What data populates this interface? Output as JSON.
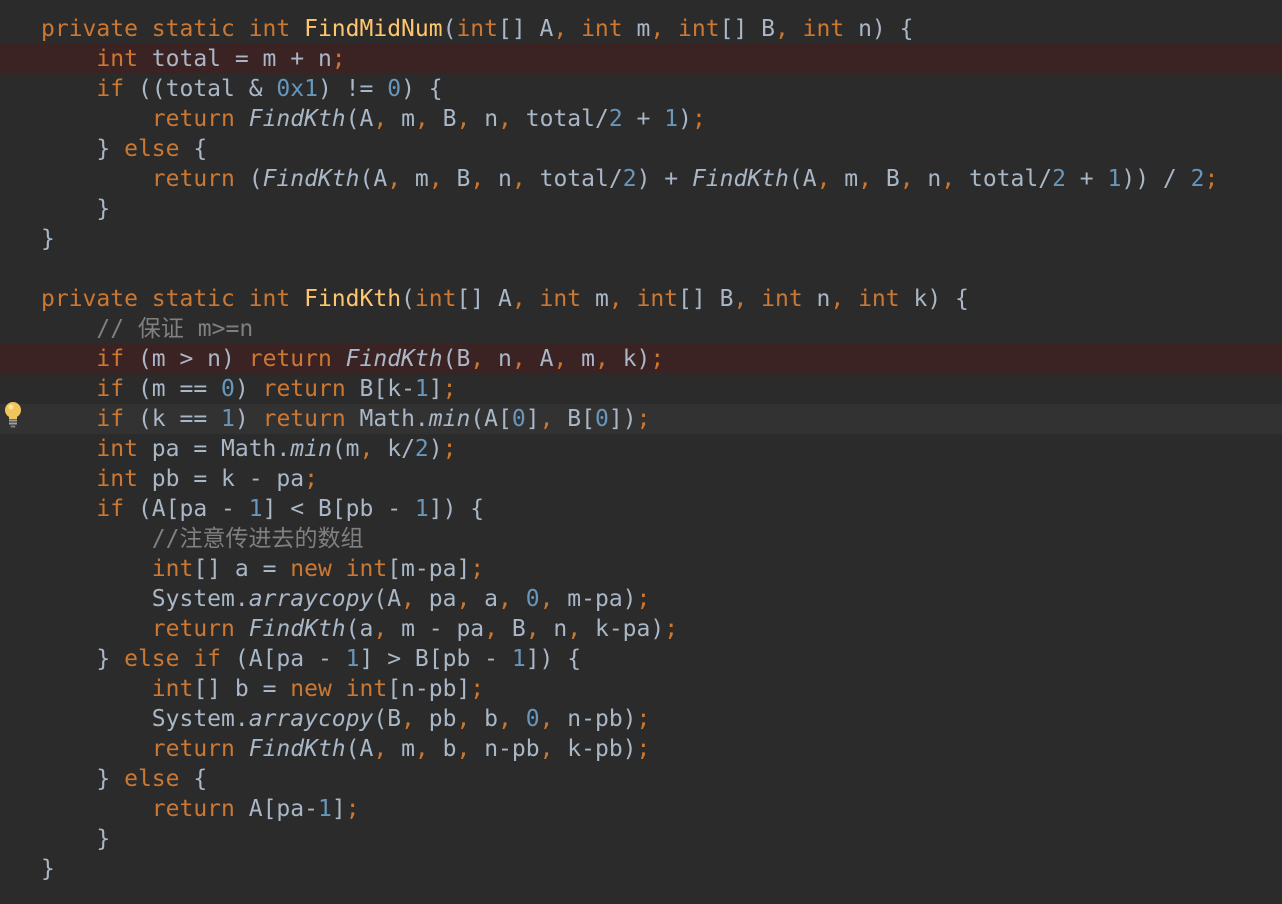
{
  "editor": {
    "language": "Java",
    "colors": {
      "background": "#2b2b2b",
      "keyword": "#cc7832",
      "method_declaration": "#ffc66d",
      "number": "#6897bb",
      "text": "#a9b7c6",
      "comment": "#808080",
      "error_line_background": "#3b2324",
      "caret_line_background": "#323232"
    },
    "gutter": {
      "intention_icon": "lightbulb-icon",
      "intention_line": 15
    },
    "lines": [
      {
        "hl": "",
        "tokens": [
          [
            "kw",
            "private static int "
          ],
          [
            "fn",
            "FindMidNum"
          ],
          [
            "tx",
            "("
          ],
          [
            "kw",
            "int"
          ],
          [
            "tx",
            "[] A"
          ],
          [
            "kw",
            ", int "
          ],
          [
            "tx",
            "m"
          ],
          [
            "kw",
            ", int"
          ],
          [
            "tx",
            "[] B"
          ],
          [
            "kw",
            ", int "
          ],
          [
            "tx",
            "n) {"
          ]
        ]
      },
      {
        "hl": "error",
        "tokens": [
          [
            "kw",
            "    int "
          ],
          [
            "tx",
            "total = m + n"
          ],
          [
            "kw",
            ";"
          ]
        ]
      },
      {
        "hl": "",
        "tokens": [
          [
            "kw",
            "    if "
          ],
          [
            "tx",
            "((total & "
          ],
          [
            "num",
            "0x1"
          ],
          [
            "tx",
            ") != "
          ],
          [
            "num",
            "0"
          ],
          [
            "tx",
            ") {"
          ]
        ]
      },
      {
        "hl": "",
        "tokens": [
          [
            "kw",
            "        return "
          ],
          [
            "it",
            "FindKth"
          ],
          [
            "tx",
            "(A"
          ],
          [
            "kw",
            ", "
          ],
          [
            "tx",
            "m"
          ],
          [
            "kw",
            ", "
          ],
          [
            "tx",
            "B"
          ],
          [
            "kw",
            ", "
          ],
          [
            "tx",
            "n"
          ],
          [
            "kw",
            ", "
          ],
          [
            "tx",
            "total/"
          ],
          [
            "num",
            "2"
          ],
          [
            "tx",
            " + "
          ],
          [
            "num",
            "1"
          ],
          [
            "tx",
            ")"
          ],
          [
            "kw",
            ";"
          ]
        ]
      },
      {
        "hl": "",
        "tokens": [
          [
            "tx",
            "    } "
          ],
          [
            "kw",
            "else "
          ],
          [
            "tx",
            "{"
          ]
        ]
      },
      {
        "hl": "",
        "tokens": [
          [
            "kw",
            "        return "
          ],
          [
            "tx",
            "("
          ],
          [
            "it",
            "FindKth"
          ],
          [
            "tx",
            "(A"
          ],
          [
            "kw",
            ", "
          ],
          [
            "tx",
            "m"
          ],
          [
            "kw",
            ", "
          ],
          [
            "tx",
            "B"
          ],
          [
            "kw",
            ", "
          ],
          [
            "tx",
            "n"
          ],
          [
            "kw",
            ", "
          ],
          [
            "tx",
            "total/"
          ],
          [
            "num",
            "2"
          ],
          [
            "tx",
            ") + "
          ],
          [
            "it",
            "FindKth"
          ],
          [
            "tx",
            "(A"
          ],
          [
            "kw",
            ", "
          ],
          [
            "tx",
            "m"
          ],
          [
            "kw",
            ", "
          ],
          [
            "tx",
            "B"
          ],
          [
            "kw",
            ", "
          ],
          [
            "tx",
            "n"
          ],
          [
            "kw",
            ", "
          ],
          [
            "tx",
            "total/"
          ],
          [
            "num",
            "2"
          ],
          [
            "tx",
            " + "
          ],
          [
            "num",
            "1"
          ],
          [
            "tx",
            ")) / "
          ],
          [
            "num",
            "2"
          ],
          [
            "kw",
            ";"
          ]
        ]
      },
      {
        "hl": "",
        "tokens": [
          [
            "tx",
            "    }"
          ]
        ]
      },
      {
        "hl": "",
        "tokens": [
          [
            "tx",
            "}"
          ]
        ]
      },
      {
        "hl": "",
        "tokens": []
      },
      {
        "hl": "",
        "tokens": [
          [
            "kw",
            "private static int "
          ],
          [
            "fn",
            "FindKth"
          ],
          [
            "tx",
            "("
          ],
          [
            "kw",
            "int"
          ],
          [
            "tx",
            "[] A"
          ],
          [
            "kw",
            ", int "
          ],
          [
            "tx",
            "m"
          ],
          [
            "kw",
            ", int"
          ],
          [
            "tx",
            "[] B"
          ],
          [
            "kw",
            ", int "
          ],
          [
            "tx",
            "n"
          ],
          [
            "kw",
            ", int "
          ],
          [
            "tx",
            "k) {"
          ]
        ]
      },
      {
        "hl": "",
        "tokens": [
          [
            "cm",
            "    // 保证 m>=n"
          ]
        ]
      },
      {
        "hl": "error",
        "tokens": [
          [
            "kw",
            "    if "
          ],
          [
            "tx",
            "(m > n) "
          ],
          [
            "kw",
            "return "
          ],
          [
            "it",
            "FindKth"
          ],
          [
            "tx",
            "(B"
          ],
          [
            "kw",
            ", "
          ],
          [
            "tx",
            "n"
          ],
          [
            "kw",
            ", "
          ],
          [
            "tx",
            "A"
          ],
          [
            "kw",
            ", "
          ],
          [
            "tx",
            "m"
          ],
          [
            "kw",
            ", "
          ],
          [
            "tx",
            "k)"
          ],
          [
            "kw",
            ";"
          ]
        ]
      },
      {
        "hl": "",
        "tokens": [
          [
            "kw",
            "    if "
          ],
          [
            "tx",
            "(m == "
          ],
          [
            "num",
            "0"
          ],
          [
            "tx",
            ") "
          ],
          [
            "kw",
            "return "
          ],
          [
            "tx",
            "B[k-"
          ],
          [
            "num",
            "1"
          ],
          [
            "tx",
            "]"
          ],
          [
            "kw",
            ";"
          ]
        ]
      },
      {
        "hl": "caret",
        "tokens": [
          [
            "kw",
            "    if "
          ],
          [
            "tx",
            "(k == "
          ],
          [
            "num",
            "1"
          ],
          [
            "tx",
            ") "
          ],
          [
            "kw",
            "return "
          ],
          [
            "tx",
            "Math."
          ],
          [
            "it",
            "min"
          ],
          [
            "tx",
            "(A["
          ],
          [
            "num",
            "0"
          ],
          [
            "tx",
            "]"
          ],
          [
            "kw",
            ", "
          ],
          [
            "tx",
            "B["
          ],
          [
            "num",
            "0"
          ],
          [
            "tx",
            "])"
          ],
          [
            "kw",
            ";"
          ]
        ]
      },
      {
        "hl": "",
        "tokens": [
          [
            "kw",
            "    int "
          ],
          [
            "tx",
            "pa = Math."
          ],
          [
            "it",
            "min"
          ],
          [
            "tx",
            "(m"
          ],
          [
            "kw",
            ", "
          ],
          [
            "tx",
            "k/"
          ],
          [
            "num",
            "2"
          ],
          [
            "tx",
            ")"
          ],
          [
            "kw",
            ";"
          ]
        ]
      },
      {
        "hl": "",
        "tokens": [
          [
            "kw",
            "    int "
          ],
          [
            "tx",
            "pb = k - pa"
          ],
          [
            "kw",
            ";"
          ]
        ]
      },
      {
        "hl": "",
        "tokens": [
          [
            "kw",
            "    if "
          ],
          [
            "tx",
            "(A[pa - "
          ],
          [
            "num",
            "1"
          ],
          [
            "tx",
            "] < B[pb - "
          ],
          [
            "num",
            "1"
          ],
          [
            "tx",
            "]) {"
          ]
        ]
      },
      {
        "hl": "",
        "tokens": [
          [
            "cm",
            "        //注意传进去的数组"
          ]
        ]
      },
      {
        "hl": "",
        "tokens": [
          [
            "kw",
            "        int"
          ],
          [
            "tx",
            "[] a = "
          ],
          [
            "kw",
            "new int"
          ],
          [
            "tx",
            "[m-pa]"
          ],
          [
            "kw",
            ";"
          ]
        ]
      },
      {
        "hl": "",
        "tokens": [
          [
            "tx",
            "        System."
          ],
          [
            "it",
            "arraycopy"
          ],
          [
            "tx",
            "(A"
          ],
          [
            "kw",
            ", "
          ],
          [
            "tx",
            "pa"
          ],
          [
            "kw",
            ", "
          ],
          [
            "tx",
            "a"
          ],
          [
            "kw",
            ", "
          ],
          [
            "num",
            "0"
          ],
          [
            "kw",
            ", "
          ],
          [
            "tx",
            "m-pa)"
          ],
          [
            "kw",
            ";"
          ]
        ]
      },
      {
        "hl": "",
        "tokens": [
          [
            "kw",
            "        return "
          ],
          [
            "it",
            "FindKth"
          ],
          [
            "tx",
            "(a"
          ],
          [
            "kw",
            ", "
          ],
          [
            "tx",
            "m - pa"
          ],
          [
            "kw",
            ", "
          ],
          [
            "tx",
            "B"
          ],
          [
            "kw",
            ", "
          ],
          [
            "tx",
            "n"
          ],
          [
            "kw",
            ", "
          ],
          [
            "tx",
            "k-pa)"
          ],
          [
            "kw",
            ";"
          ]
        ]
      },
      {
        "hl": "",
        "tokens": [
          [
            "tx",
            "    } "
          ],
          [
            "kw",
            "else if "
          ],
          [
            "tx",
            "(A[pa - "
          ],
          [
            "num",
            "1"
          ],
          [
            "tx",
            "] > B[pb - "
          ],
          [
            "num",
            "1"
          ],
          [
            "tx",
            "]) {"
          ]
        ]
      },
      {
        "hl": "",
        "tokens": [
          [
            "kw",
            "        int"
          ],
          [
            "tx",
            "[] b = "
          ],
          [
            "kw",
            "new int"
          ],
          [
            "tx",
            "[n-pb]"
          ],
          [
            "kw",
            ";"
          ]
        ]
      },
      {
        "hl": "",
        "tokens": [
          [
            "tx",
            "        System."
          ],
          [
            "it",
            "arraycopy"
          ],
          [
            "tx",
            "(B"
          ],
          [
            "kw",
            ", "
          ],
          [
            "tx",
            "pb"
          ],
          [
            "kw",
            ", "
          ],
          [
            "tx",
            "b"
          ],
          [
            "kw",
            ", "
          ],
          [
            "num",
            "0"
          ],
          [
            "kw",
            ", "
          ],
          [
            "tx",
            "n-pb)"
          ],
          [
            "kw",
            ";"
          ]
        ]
      },
      {
        "hl": "",
        "tokens": [
          [
            "kw",
            "        return "
          ],
          [
            "it",
            "FindKth"
          ],
          [
            "tx",
            "(A"
          ],
          [
            "kw",
            ", "
          ],
          [
            "tx",
            "m"
          ],
          [
            "kw",
            ", "
          ],
          [
            "tx",
            "b"
          ],
          [
            "kw",
            ", "
          ],
          [
            "tx",
            "n-pb"
          ],
          [
            "kw",
            ", "
          ],
          [
            "tx",
            "k-pb)"
          ],
          [
            "kw",
            ";"
          ]
        ]
      },
      {
        "hl": "",
        "tokens": [
          [
            "tx",
            "    } "
          ],
          [
            "kw",
            "else "
          ],
          [
            "tx",
            "{"
          ]
        ]
      },
      {
        "hl": "",
        "tokens": [
          [
            "kw",
            "        return "
          ],
          [
            "tx",
            "A[pa-"
          ],
          [
            "num",
            "1"
          ],
          [
            "tx",
            "]"
          ],
          [
            "kw",
            ";"
          ]
        ]
      },
      {
        "hl": "",
        "tokens": [
          [
            "tx",
            "    }"
          ]
        ]
      },
      {
        "hl": "",
        "tokens": [
          [
            "tx",
            "}"
          ]
        ]
      }
    ]
  }
}
